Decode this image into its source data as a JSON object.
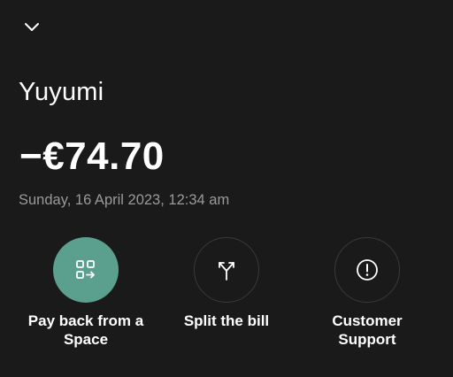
{
  "header": {
    "collapse_icon": "chevron-down-icon"
  },
  "transaction": {
    "merchant": "Yuyumi",
    "amount": "−€74.70",
    "datetime": "Sunday, 16 April 2023, 12:34 am"
  },
  "actions": [
    {
      "label": "Pay back from a Space",
      "icon": "space-transfer-icon",
      "style": "primary"
    },
    {
      "label": "Split the bill",
      "icon": "split-arrows-icon",
      "style": "outline"
    },
    {
      "label": "Customer Support",
      "icon": "exclamation-circle-icon",
      "style": "outline"
    }
  ],
  "colors": {
    "background": "#1a1a1a",
    "accent": "#5ba08e",
    "secondary_text": "#9a9a9a",
    "outline": "#3a3a3a"
  }
}
